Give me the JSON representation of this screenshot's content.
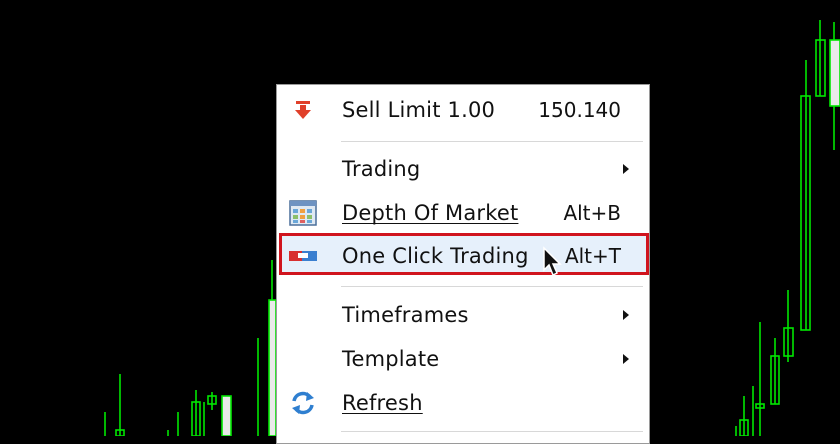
{
  "colors": {
    "chart_background": "#000000",
    "candle_green": "#00e600",
    "menu_background": "#ffffff",
    "highlight_border": "#d0141e",
    "highlight_fill": "#e6f0fb"
  },
  "context_menu": {
    "items": [
      {
        "label": "Sell Limit 1.00",
        "value": "150.140",
        "icon": "sell-limit-arrow-icon"
      },
      {
        "label": "Trading",
        "icon": "",
        "submenu": true
      },
      {
        "label": "Depth Of Market",
        "mnemonic": "D",
        "shortcut": "Alt+B",
        "icon": "depth-of-market-icon"
      },
      {
        "label": "One Click Trading",
        "mnemonic": "k",
        "shortcut": "Alt+T",
        "icon": "one-click-trading-icon",
        "selected": true
      },
      {
        "label": "Timeframes",
        "icon": "",
        "submenu": true
      },
      {
        "label": "Template",
        "icon": "",
        "submenu": true
      },
      {
        "label": "Refresh",
        "mnemonic": "R",
        "icon": "refresh-icon"
      }
    ]
  }
}
